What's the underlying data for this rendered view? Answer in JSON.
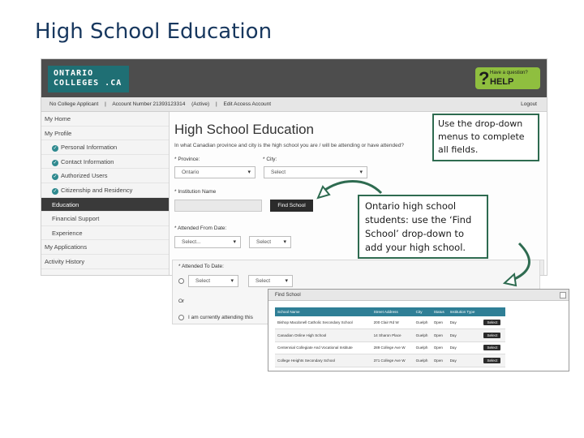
{
  "slide": {
    "title": "High School Education"
  },
  "brand": {
    "logo_line1": "ONTARIO",
    "logo_line2": "COLLEGES .CA"
  },
  "help": {
    "small": "Have a question?",
    "big": "HELP"
  },
  "account": {
    "applicant": "No College Applicant",
    "account_number": "Account Number 21393123314",
    "status": "(Active)",
    "separator": "|",
    "edit": "Edit Access Account",
    "logout": "Logout"
  },
  "sidebar": {
    "items": [
      {
        "label": "My Home"
      },
      {
        "label": "My Profile"
      },
      {
        "label": "Personal Information"
      },
      {
        "label": "Contact Information"
      },
      {
        "label": "Authorized Users"
      },
      {
        "label": "Citizenship and Residency"
      },
      {
        "label": "Education"
      },
      {
        "label": "Financial Support"
      },
      {
        "label": "Experience"
      },
      {
        "label": "My Applications"
      },
      {
        "label": "Activity History"
      }
    ]
  },
  "form": {
    "title": "High School Education",
    "prompt": "In what Canadian province and city is the high school you are / will be attending or have attended?",
    "province_label": "* Province:",
    "province_value": "Ontario",
    "city_label": "* City:",
    "city_value": "Select",
    "institution_label": "* Institution Name",
    "find_button": "Find School",
    "attended_from_label": "* Attended From Date:",
    "from_month": "Select...",
    "from_year": "Select",
    "attended_to_label": "* Attended To Date:",
    "to_month": "Select",
    "to_year": "Select",
    "or_label": "Or",
    "currently_attending": "I am currently attending this"
  },
  "popup": {
    "title": "Find School",
    "columns": [
      "School Name",
      "Street Address",
      "City",
      "Status",
      "Institution Type",
      ""
    ],
    "rows": [
      [
        "Bishop Macdonell Catholic Secondary School",
        "200 Clair Rd W",
        "Guelph",
        "Open",
        "Day",
        "Select"
      ],
      [
        "Canadian Online High School",
        "14 Sharon Place",
        "Guelph",
        "Open",
        "Day",
        "Select"
      ],
      [
        "Centennial Collegiate And Vocational Institute",
        "289 College Ave W",
        "Guelph",
        "Open",
        "Day",
        "Select"
      ],
      [
        "College Heights Secondary School",
        "371 College Ave W",
        "Guelph",
        "Open",
        "Day",
        "Select"
      ]
    ]
  },
  "callouts": {
    "dropdown_tip": "Use the drop-down menus to complete all fields.",
    "find_tip": "Ontario high school students:  use the ‘Find School’ drop-down to add your high school."
  },
  "colors": {
    "accent": "#2f7f96",
    "callout_border": "#2e6b50",
    "help": "#8fbf3f"
  }
}
